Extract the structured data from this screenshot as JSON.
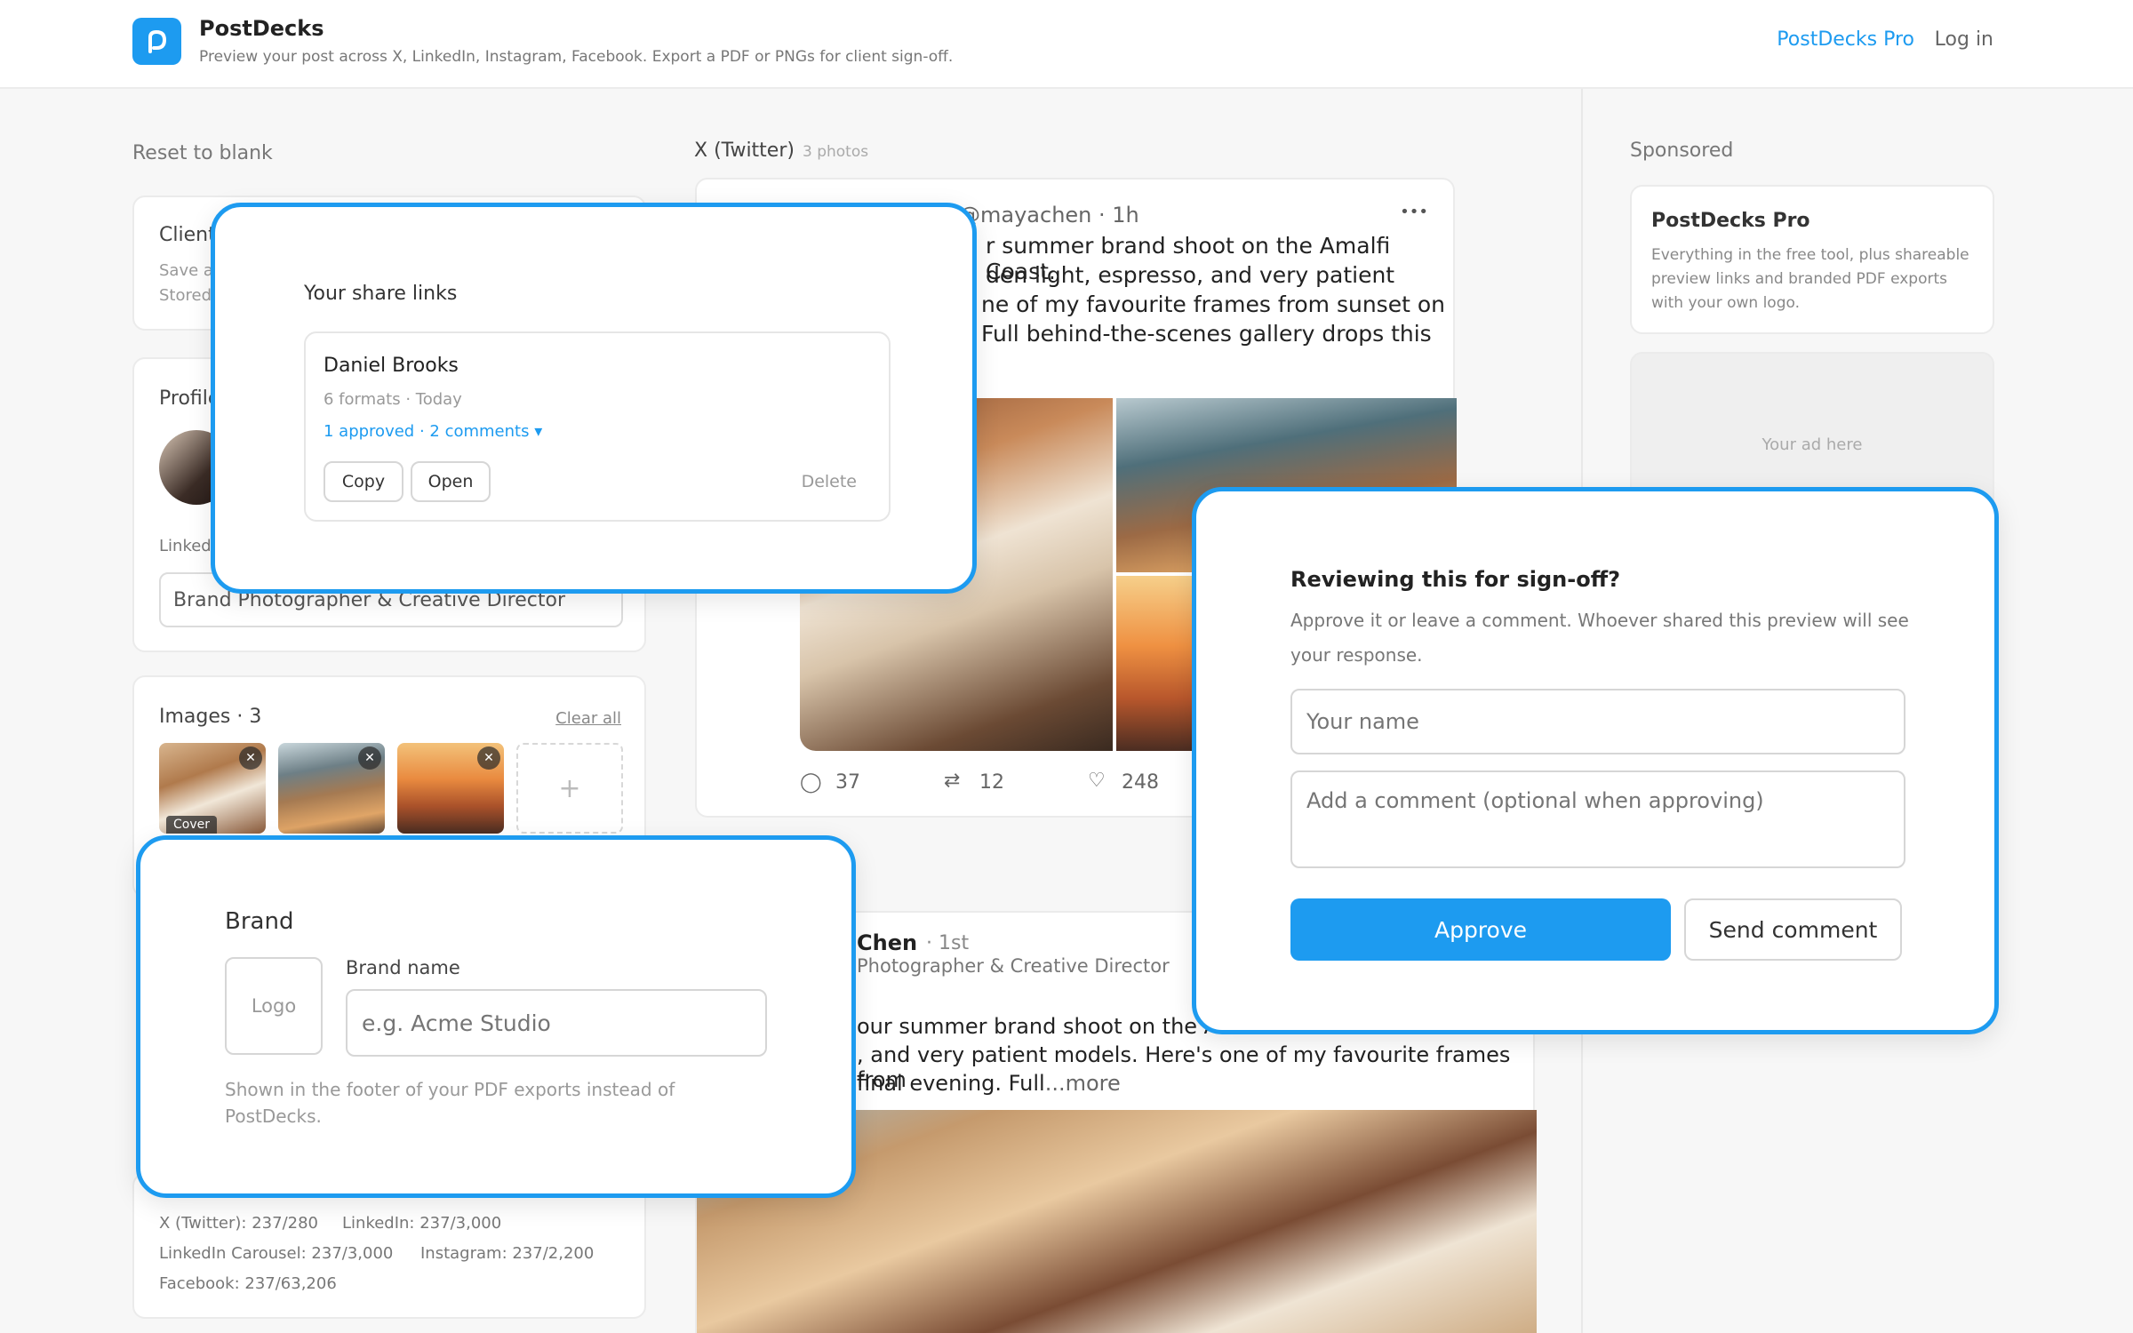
{
  "header": {
    "app_name": "PostDecks",
    "tagline": "Preview your post across X, LinkedIn, Instagram, Facebook. Export a PDF or PNGs for client sign-off.",
    "pro_link": "PostDecks Pro",
    "login_link": "Log in"
  },
  "left": {
    "reset_label": "Reset to blank",
    "client_card": {
      "title": "Client",
      "line1": "Save a",
      "line2": "Stored"
    },
    "profile_card": {
      "title": "Profile",
      "linked_label": "Linked",
      "headline_value": "Brand Photographer & Creative Director"
    },
    "images_card": {
      "title": "Images · 3",
      "clear_all": "Clear all",
      "cover_tag": "Cover",
      "add_symbol": "+"
    },
    "counts": {
      "x": "X (Twitter): 237/280",
      "linkedin": "LinkedIn: 237/3,000",
      "carousel": "LinkedIn Carousel: 237/3,000",
      "instagram": "Instagram: 237/2,200",
      "facebook": "Facebook: 237/63,206"
    }
  },
  "center": {
    "x_section_title": "X (Twitter)",
    "x_section_meta": "3 photos",
    "x_post": {
      "handle_time": "@mayachen · 1h",
      "more_icon": "•••",
      "lines": [
        "r summer brand shoot on the Amalfi Coast.",
        "den light, espresso, and very patient",
        "ne of my favourite frames from sunset on",
        "Full behind-the-scenes gallery drops this"
      ],
      "replies": "37",
      "reposts": "12",
      "likes": "248"
    },
    "linkedin_post": {
      "name": "Chen",
      "degree": "· 1st",
      "headline": "Photographer & Creative Director",
      "lines": [
        "our summer brand shoot on the Amal",
        ", and very patient models. Here's one of my favourite frames from",
        "final evening. Full"
      ],
      "more": "...more"
    }
  },
  "right": {
    "sponsored_label": "Sponsored",
    "ad_card": {
      "title": "PostDecks Pro",
      "body": "Everything in the free tool, plus shareable preview links and branded PDF exports with your own logo."
    },
    "ad_placeholder": "Your ad here"
  },
  "share_overlay": {
    "title": "Your share links",
    "item": {
      "name": "Daniel Brooks",
      "meta": "6 formats · Today",
      "status": "1 approved · 2 comments",
      "copy": "Copy",
      "open": "Open",
      "delete": "Delete"
    }
  },
  "brand_overlay": {
    "title": "Brand",
    "logo_label": "Logo",
    "name_label": "Brand name",
    "name_placeholder": "e.g. Acme Studio",
    "help": "Shown in the footer of your PDF exports instead of PostDecks."
  },
  "review_overlay": {
    "title": "Reviewing this for sign-off?",
    "desc": "Approve it or leave a comment. Whoever shared this preview will see your response.",
    "name_placeholder": "Your name",
    "comment_placeholder": "Add a comment (optional when approving)",
    "approve": "Approve",
    "send": "Send comment"
  },
  "colors": {
    "accent": "#1d9bf0"
  }
}
